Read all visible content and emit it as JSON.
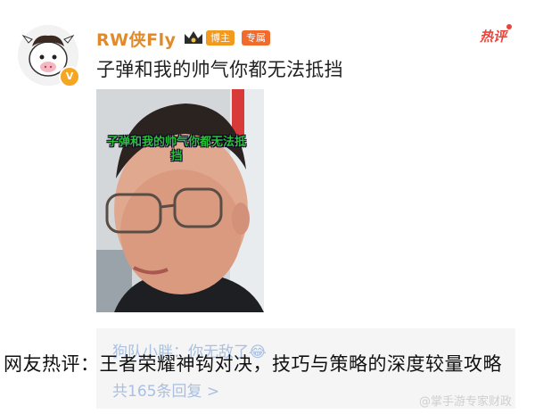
{
  "post": {
    "username": "RW侠Fly",
    "badges": {
      "blogger": "博主",
      "exclusive": "专属"
    },
    "hot_tag": "热评",
    "text": "子弹和我的帅气你都无法抵挡",
    "photo_caption": "子弹和我的帅气你都无法抵挡",
    "verified_icon": "v-badge"
  },
  "reply": {
    "first_line": "狗队小胖：你无敌了😂",
    "count_text": "共165条回复 >"
  },
  "overlay_title": "网友热评：王者荣耀神钩对决，技巧与策略的深度较量攻略",
  "watermark": "@掌手游专家财政",
  "colors": {
    "username": "#e08a2c",
    "hot": "#e8453c",
    "reply": "#a9c0e0"
  }
}
